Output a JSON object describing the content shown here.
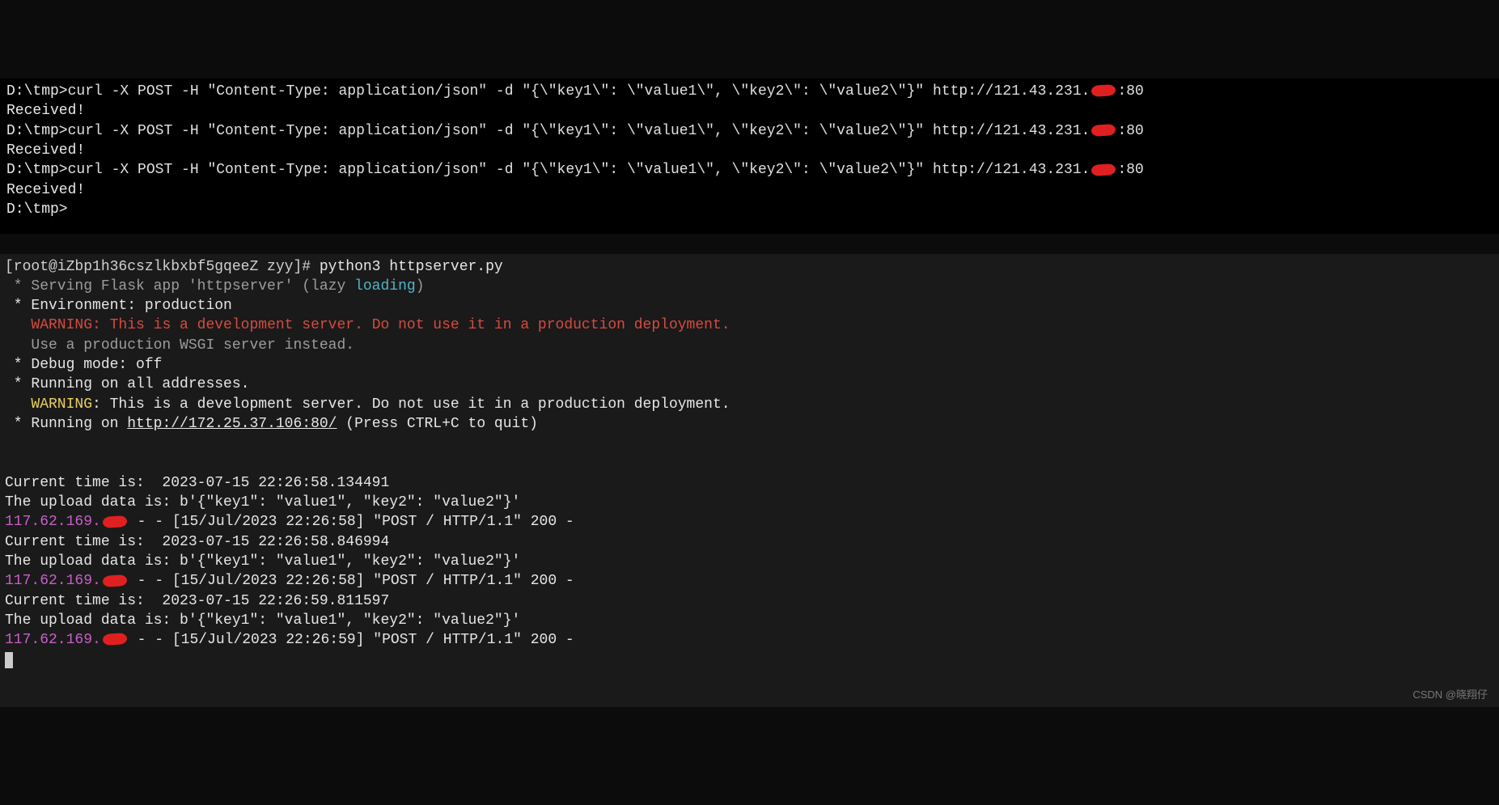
{
  "top_terminal": {
    "prompt": "D:\\tmp>",
    "curl_cmd": "curl -X POST -H \"Content-Type: application/json\" -d \"{\\\"key1\\\": \\\"value1\\\", \\\"key2\\\": \\\"value2\\\"}\" http://121.43.231.",
    "curl_port": ":80",
    "response": "Received!",
    "repeat_count": 3
  },
  "bottom_terminal": {
    "shell_prompt": "[root@iZbp1h36cszlkbxbf5gqeeZ zyy]# ",
    "command": "python3 httpserver.py",
    "flask_lines": {
      "serving_pre": " * Serving Flask app 'httpserver' (lazy ",
      "serving_load": "loading",
      "serving_post": ")",
      "env": " * Environment: production",
      "warn_label": "   WARNING",
      "warn_text": ": This is a development server. Do not use it in a production deployment.",
      "use_prod": "   Use a production WSGI server instead.",
      "debug": " * Debug mode: off",
      "running_all": " * Running on all addresses.",
      "warn2_label": "   WARNING",
      "warn2_text": ": This is a development server. Do not use it in a production deployment.",
      "running_on_pre": " * Running on ",
      "running_url": "http://172.25.37.106:80/",
      "running_on_post": " (Press CTRL+C to quit)"
    },
    "requests": [
      {
        "time_line": "Current time is:  2023-07-15 22:26:58.134491",
        "data_line": "The upload data is: b'{\"key1\": \"value1\", \"key2\": \"value2\"}'",
        "ip": "117.62.169.",
        "log_rest": " - - [15/Jul/2023 22:26:58] \"POST / HTTP/1.1\" 200 -"
      },
      {
        "time_line": "Current time is:  2023-07-15 22:26:58.846994",
        "data_line": "The upload data is: b'{\"key1\": \"value1\", \"key2\": \"value2\"}'",
        "ip": "117.62.169.",
        "log_rest": " - - [15/Jul/2023 22:26:58] \"POST / HTTP/1.1\" 200 -"
      },
      {
        "time_line": "Current time is:  2023-07-15 22:26:59.811597",
        "data_line": "The upload data is: b'{\"key1\": \"value1\", \"key2\": \"value2\"}'",
        "ip": "117.62.169.",
        "log_rest": " - - [15/Jul/2023 22:26:59] \"POST / HTTP/1.1\" 200 -"
      }
    ]
  },
  "watermark": "CSDN @晓翔仔"
}
